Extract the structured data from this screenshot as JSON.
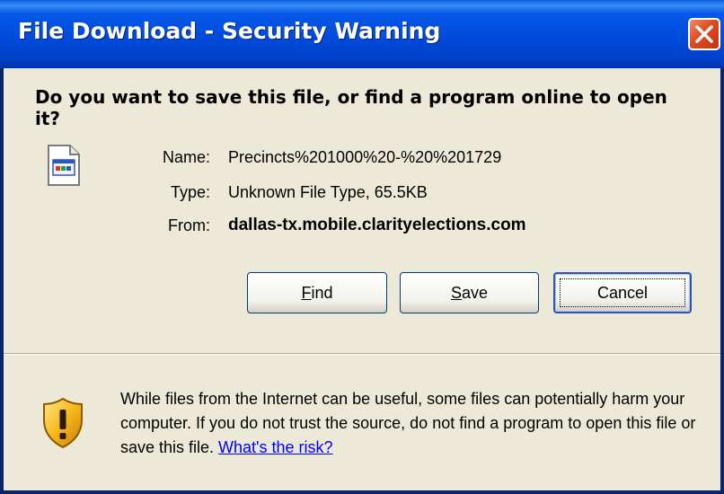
{
  "window": {
    "title": "File Download - Security Warning"
  },
  "dialog": {
    "question": "Do you want to save this file, or find a program online to open it?",
    "fields": [
      {
        "label": "Name:",
        "value": "Precincts%201000%20-%20%201729"
      },
      {
        "label": "Type:",
        "value": "Unknown File Type, 65.5KB"
      },
      {
        "label": "From:",
        "value": "dallas-tx.mobile.clarityelections.com"
      }
    ],
    "buttons": {
      "find": {
        "mnemonic": "F",
        "rest": "ind"
      },
      "save": {
        "mnemonic": "S",
        "rest": "ave"
      },
      "cancel": {
        "label": "Cancel"
      }
    },
    "warning": {
      "text": "While files from the Internet can be useful, some files can potentially harm your computer. If you do not trust the source, do not find a program to open this file or save this file. ",
      "link": "What's the risk?"
    }
  },
  "icons": {
    "file": "generic-file-icon",
    "warning": "security-shield-icon",
    "close": "close-icon"
  },
  "colors": {
    "titlebar": "#0049d8",
    "close_button": "#dd4a22",
    "dialog_background": "#ece9d8",
    "link": "#0000ff"
  }
}
